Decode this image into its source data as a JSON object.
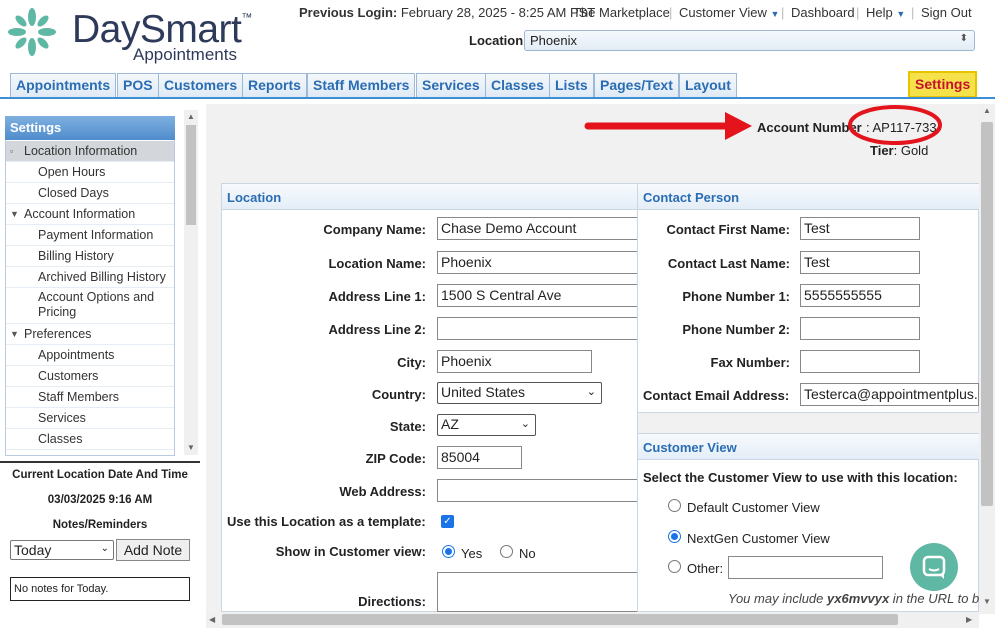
{
  "brand": {
    "name": "DaySmart",
    "tagline": "Appointments",
    "trademark": "™"
  },
  "topnav": {
    "previous_login_label": "Previous Login:",
    "previous_login_value": "February 28, 2025 - 8:25 AM PST",
    "marketplace": "The Marketplace",
    "customer_view": "Customer View",
    "dashboard": "Dashboard",
    "help": "Help",
    "sign_out": "Sign Out"
  },
  "location_selector": {
    "label": "Location",
    "value": "Phoenix"
  },
  "tabs": [
    "Appointments",
    "POS",
    "Customers",
    "Reports",
    "Staff Members",
    "Services",
    "Classes",
    "Lists",
    "Pages/Text",
    "Layout"
  ],
  "settings_tab": "Settings",
  "sidebar": {
    "title": "Settings",
    "items": [
      {
        "label": "Location Information",
        "level": 0,
        "marker": "▫",
        "selected": true
      },
      {
        "label": "Open Hours",
        "level": 1
      },
      {
        "label": "Closed Days",
        "level": 1
      },
      {
        "label": "Account Information",
        "level": 0,
        "marker": "▼"
      },
      {
        "label": "Payment Information",
        "level": 1
      },
      {
        "label": "Billing History",
        "level": 1
      },
      {
        "label": "Archived Billing History",
        "level": 1
      },
      {
        "label": "Account Options and Pricing",
        "level": 1
      },
      {
        "label": "Preferences",
        "level": 0,
        "marker": "▼"
      },
      {
        "label": "Appointments",
        "level": 1
      },
      {
        "label": "Customers",
        "level": 1
      },
      {
        "label": "Staff Members",
        "level": 1
      },
      {
        "label": "Services",
        "level": 1
      },
      {
        "label": "Classes",
        "level": 1
      }
    ],
    "current_location_title": "Current Location Date And Time",
    "current_location_value": "03/03/2025 9:16 AM",
    "notes_title": "Notes/Reminders",
    "notes_filter": "Today",
    "add_note": "Add Note",
    "no_notes": "No notes for Today."
  },
  "account": {
    "number_label": "Account Number",
    "number_value": ": AP117-733",
    "tier_label": "Tier",
    "tier_value": ": Gold"
  },
  "location_panel": {
    "title": "Location",
    "company_name_label": "Company Name:",
    "company_name": "Chase Demo Account",
    "location_name_label": "Location Name:",
    "location_name": "Phoenix",
    "address1_label": "Address Line 1:",
    "address1": "1500 S Central Ave",
    "address2_label": "Address Line 2:",
    "address2": "",
    "city_label": "City:",
    "city": "Phoenix",
    "country_label": "Country:",
    "country": "United States",
    "state_label": "State:",
    "state": "AZ",
    "zip_label": "ZIP Code:",
    "zip": "85004",
    "web_label": "Web Address:",
    "web": "",
    "template_label": "Use this Location as a template:",
    "template_checked": true,
    "show_label": "Show in Customer view:",
    "yes": "Yes",
    "no": "No",
    "show_value": "Yes",
    "directions_label": "Directions:"
  },
  "contact_panel": {
    "title": "Contact Person",
    "first_label": "Contact First Name:",
    "first": "Test",
    "last_label": "Contact Last Name:",
    "last": "Test",
    "phone1_label": "Phone Number 1:",
    "phone1": "5555555555",
    "phone2_label": "Phone Number 2:",
    "phone2": "",
    "fax_label": "Fax Number:",
    "fax": "",
    "email_label": "Contact Email Address:",
    "email": "Testerca@appointmentplus."
  },
  "customer_view_panel": {
    "title": "Customer View",
    "prompt": "Select the Customer View to use with this location:",
    "options": [
      "Default Customer View",
      "NextGen Customer View",
      "Other:"
    ],
    "selected": "NextGen Customer View",
    "note_prefix": "You may include ",
    "note_code": "yx6mvvyx",
    "note_suffix": " in the URL to b"
  },
  "colors": {
    "tab_text": "#2a6db3",
    "settings_bg": "#f5e24a",
    "settings_text": "#c8102e",
    "annotation_red": "#e3141b",
    "chat_button": "#5fb8a4"
  }
}
